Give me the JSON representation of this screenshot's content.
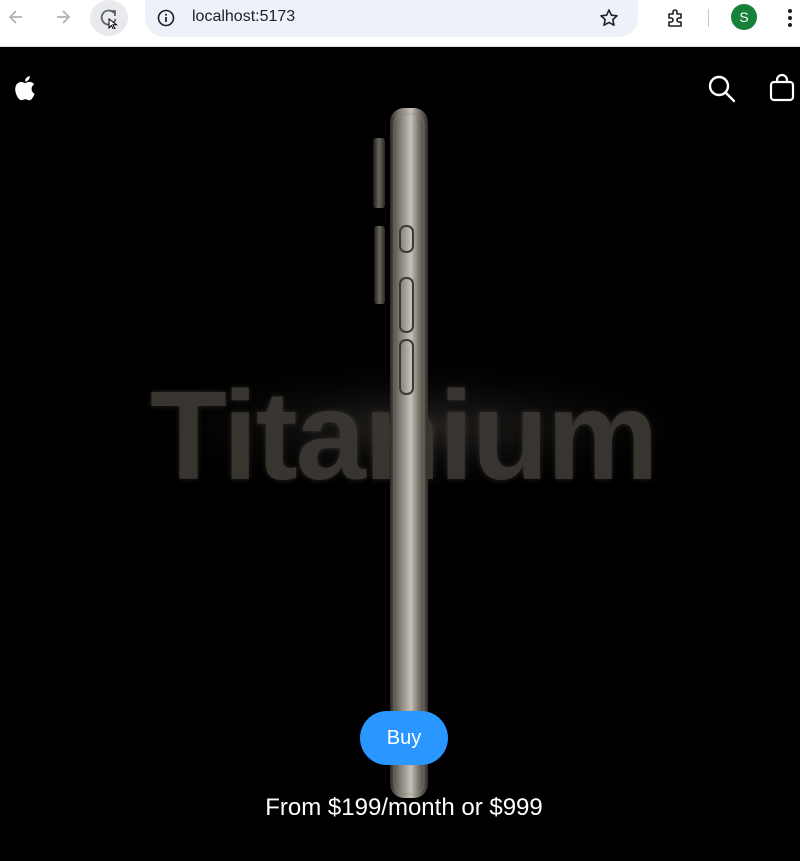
{
  "browser": {
    "url": "localhost:5173",
    "profile_initial": "S",
    "icons": {
      "back": "arrow-left-icon",
      "forward": "arrow-right-icon",
      "reload": "reload-icon",
      "info": "info-icon",
      "bookmark": "star-icon",
      "extensions": "puzzle-icon",
      "menu": "kebab-menu-icon"
    },
    "colors": {
      "omnibox_bg": "#eef1f8",
      "avatar_bg": "#188038"
    }
  },
  "nav": {
    "icons": {
      "logo": "apple-logo-icon",
      "search": "search-icon",
      "bag": "shopping-bag-icon"
    }
  },
  "hero": {
    "headline": "Titanium",
    "buy_label": "Buy",
    "price_text": "From $199/month or $999",
    "colors": {
      "accent": "#2997ff",
      "background": "#000000"
    }
  }
}
